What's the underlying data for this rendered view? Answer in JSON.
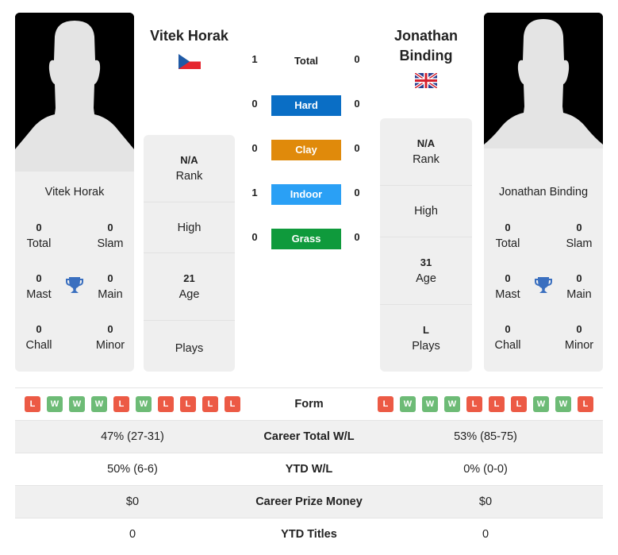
{
  "player1": {
    "name": "Vitek Horak",
    "country_flag": "czech-republic-flag",
    "titles": {
      "total": {
        "value": "0",
        "label": "Total"
      },
      "slam": {
        "value": "0",
        "label": "Slam"
      },
      "mast": {
        "value": "0",
        "label": "Mast"
      },
      "main": {
        "value": "0",
        "label": "Main"
      },
      "chall": {
        "value": "0",
        "label": "Chall"
      },
      "minor": {
        "value": "0",
        "label": "Minor"
      }
    },
    "info": {
      "rank": {
        "value": "N/A",
        "label": "Rank"
      },
      "high": {
        "value": "",
        "label": "High"
      },
      "age": {
        "value": "21",
        "label": "Age"
      },
      "plays": {
        "value": "",
        "label": "Plays"
      }
    },
    "form": [
      "L",
      "W",
      "W",
      "W",
      "L",
      "W",
      "L",
      "L",
      "L",
      "L"
    ]
  },
  "player2": {
    "name": "Jonathan Binding",
    "name_line1": "Jonathan",
    "name_line2": "Binding",
    "country_flag": "united-kingdom-flag",
    "titles": {
      "total": {
        "value": "0",
        "label": "Total"
      },
      "slam": {
        "value": "0",
        "label": "Slam"
      },
      "mast": {
        "value": "0",
        "label": "Mast"
      },
      "main": {
        "value": "0",
        "label": "Main"
      },
      "chall": {
        "value": "0",
        "label": "Chall"
      },
      "minor": {
        "value": "0",
        "label": "Minor"
      }
    },
    "info": {
      "rank": {
        "value": "N/A",
        "label": "Rank"
      },
      "high": {
        "value": "",
        "label": "High"
      },
      "age": {
        "value": "31",
        "label": "Age"
      },
      "plays": {
        "value": "L",
        "label": "Plays"
      }
    },
    "form": [
      "L",
      "W",
      "W",
      "W",
      "L",
      "L",
      "L",
      "W",
      "W",
      "L"
    ]
  },
  "h2h": {
    "total": {
      "label": "Total",
      "p1": "1",
      "p2": "0"
    },
    "surfaces": [
      {
        "label": "Hard",
        "p1": "0",
        "p2": "0",
        "color": "#0a6ec5"
      },
      {
        "label": "Clay",
        "p1": "0",
        "p2": "0",
        "color": "#e08a0b"
      },
      {
        "label": "Indoor",
        "p1": "1",
        "p2": "0",
        "color": "#2aa0f5"
      },
      {
        "label": "Grass",
        "p1": "0",
        "p2": "0",
        "color": "#0f9a3c"
      }
    ]
  },
  "comparison": {
    "form_label": "Form",
    "rows": [
      {
        "label": "Career Total W/L",
        "p1": "47% (27-31)",
        "p2": "53% (85-75)"
      },
      {
        "label": "YTD W/L",
        "p1": "50% (6-6)",
        "p2": "0% (0-0)"
      },
      {
        "label": "Career Prize Money",
        "p1": "$0",
        "p2": "$0"
      },
      {
        "label": "YTD Titles",
        "p1": "0",
        "p2": "0"
      }
    ]
  },
  "colors": {
    "loss": "#ec5a45",
    "win": "#6dbb76",
    "trophy": "#3a6fbf"
  }
}
